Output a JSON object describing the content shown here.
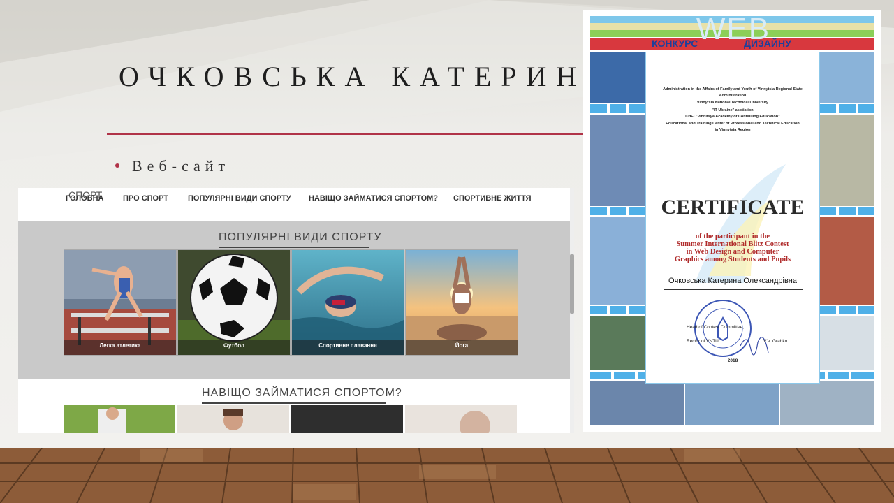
{
  "slide": {
    "title": "ОЧКОВСЬКА КАТЕРИНА",
    "bullet": "Веб-сайт",
    "accent_color": "#b03348"
  },
  "website": {
    "logo": "СПОРТ",
    "nav": [
      "ГОЛОВНА",
      "ПРО СПОРТ",
      "ПОПУЛЯРНІ ВИДИ СПОРТУ",
      "НАВІЩО ЗАЙМАТИСЯ СПОРТОМ?",
      "СПОРТИВНЕ ЖИТТЯ"
    ],
    "section1_title": "ПОПУЛЯРНІ ВИДИ СПОРТУ",
    "cards": [
      "Легка атлетика",
      "Футбол",
      "Спортивне плавання",
      "Йога"
    ],
    "section2_title": "НАВІЩО ЗАЙМАТИСЯ СПОРТОМ?"
  },
  "certificate": {
    "banner_web": "WEB",
    "banner_left": "КОНКУРС",
    "banner_right": "ДИЗАЙНУ",
    "organizers": [
      "Administration in the Affairs of Family and Youth of Vinnytsia Regional State",
      "Administration",
      "Vinnytsia National Technical University",
      "\"IT Ukraine\" asotiation",
      "CHEI \"Vinnitsya Academy of Continuing Education\"",
      "Educational and Training Center of Professional and Technical Education",
      "in Vinnytsia Region"
    ],
    "heading": "CERTIFICATE",
    "subtitle": [
      "of the participant in the",
      "Summer International Blitz Contest",
      "in Web Design and Computer",
      "Graphics among Students and Pupils"
    ],
    "recipient": "Очковська Катерина Олександрівна",
    "sign_line1": "Head of Contest Committee,",
    "sign_line2": "Rector of VNTU",
    "sign_name": "V.V. Grabko",
    "year": "2018"
  }
}
